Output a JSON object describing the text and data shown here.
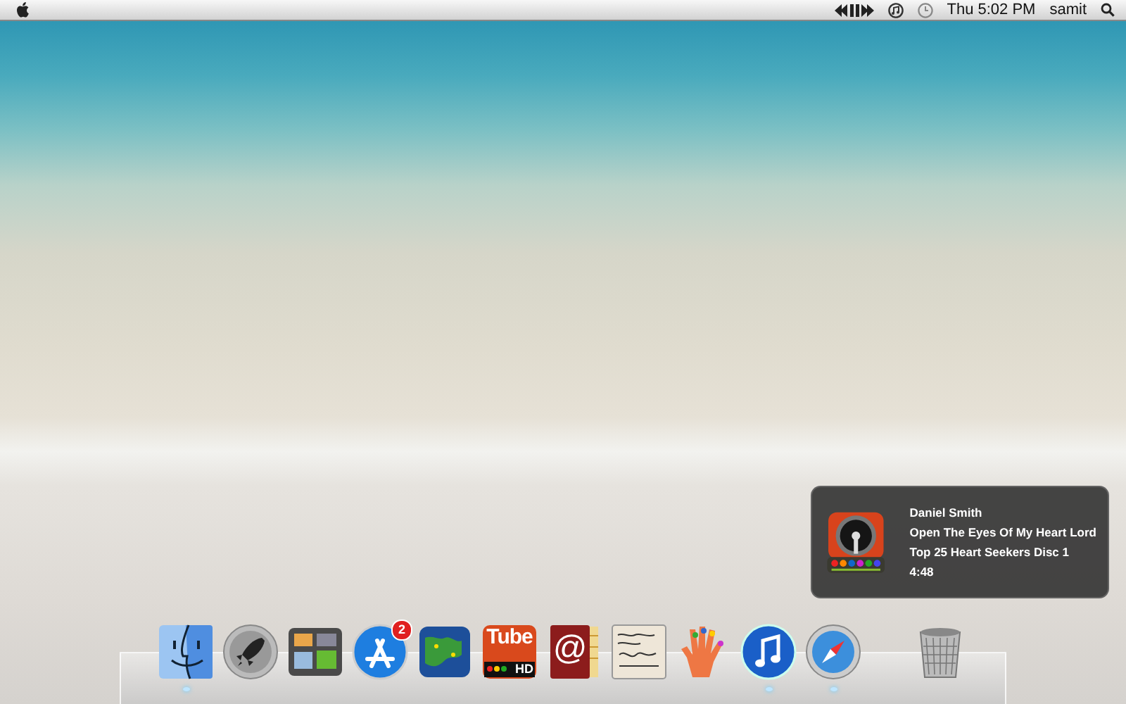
{
  "menu_bar": {
    "clock": "Thu 5:02 PM",
    "user": "samit"
  },
  "notification": {
    "artist": "Daniel Smith",
    "title": "Open The Eyes Of My Heart Lord",
    "album": "Top 25 Heart Seekers Disc 1",
    "duration": "4:48"
  },
  "dock": {
    "apps": [
      {
        "kind": "finder",
        "running": true
      },
      {
        "kind": "launchpad",
        "running": false
      },
      {
        "kind": "mission",
        "running": false
      },
      {
        "kind": "appstore",
        "running": false,
        "badge": "2"
      },
      {
        "kind": "globe",
        "running": false
      },
      {
        "kind": "tube",
        "running": false,
        "label": "Tube",
        "sublabel": "HD"
      },
      {
        "kind": "contacts",
        "running": false,
        "label": "@"
      },
      {
        "kind": "signature",
        "running": false
      },
      {
        "kind": "hand",
        "running": false
      },
      {
        "kind": "itunes",
        "running": true
      },
      {
        "kind": "safari",
        "running": true
      },
      {
        "kind": "trash",
        "running": false
      }
    ]
  }
}
